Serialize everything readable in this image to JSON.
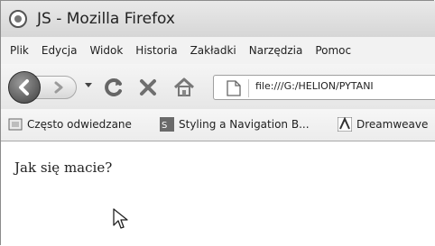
{
  "window": {
    "title": "JS - Mozilla Firefox"
  },
  "menu": [
    "Plik",
    "Edycja",
    "Widok",
    "Historia",
    "Zakładki",
    "Narzędzia",
    "Pomoc"
  ],
  "nav": {
    "url": "file:///G:/HELION/PYTANI"
  },
  "bookmarks": [
    "Często odwiedzane",
    "Styling a Navigation B...",
    "Dreamweave"
  ],
  "content": {
    "text": "Jak się macie?"
  },
  "icons": [
    "firefox-icon",
    "back-arrow-icon",
    "forward-arrow-icon",
    "chevron-down-icon",
    "reload-icon",
    "stop-icon",
    "home-icon",
    "page-icon",
    "bookmark-folder-icon",
    "ps-icon",
    "adobe-icon",
    "mouse-pointer-icon"
  ]
}
